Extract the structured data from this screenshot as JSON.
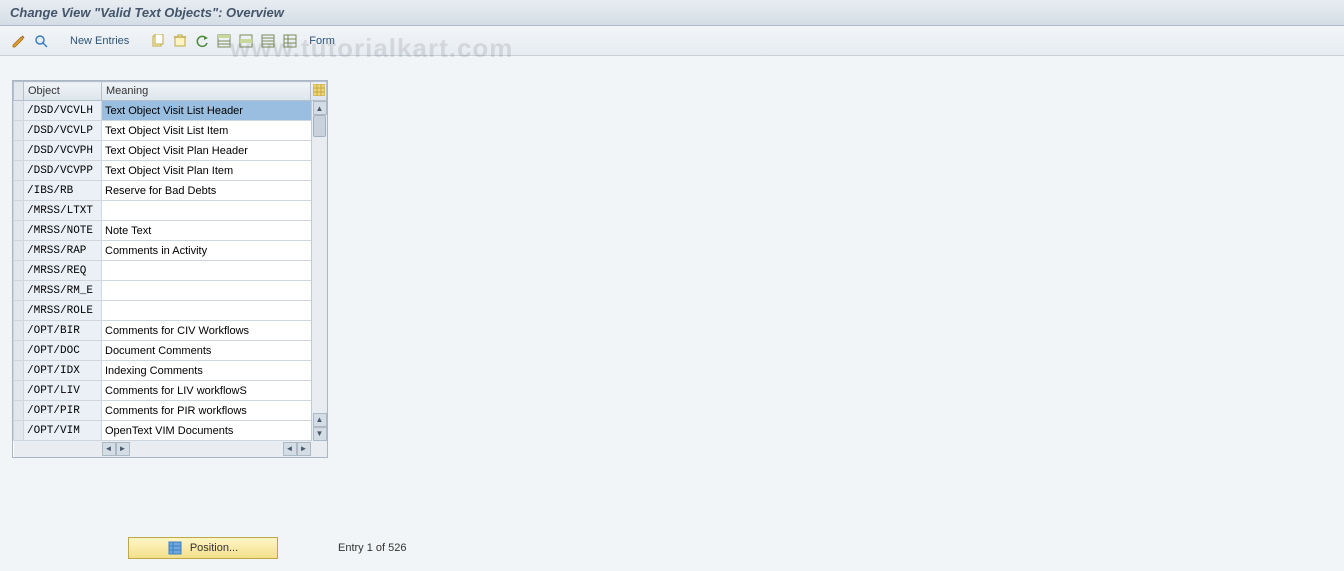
{
  "title": "Change View \"Valid Text Objects\": Overview",
  "toolbar": {
    "new_entries": "New Entries",
    "form": "Form"
  },
  "watermark": "www.tutorialkart.com",
  "table": {
    "col_object": "Object",
    "col_meaning": "Meaning",
    "rows": [
      {
        "object": "/DSD/VCVLH",
        "meaning": "Text Object Visit List Header",
        "selected": true
      },
      {
        "object": "/DSD/VCVLP",
        "meaning": "Text Object Visit List Item"
      },
      {
        "object": "/DSD/VCVPH",
        "meaning": "Text Object Visit Plan Header"
      },
      {
        "object": "/DSD/VCVPP",
        "meaning": "Text Object Visit Plan Item"
      },
      {
        "object": "/IBS/RB",
        "meaning": "Reserve for Bad Debts"
      },
      {
        "object": "/MRSS/LTXT",
        "meaning": ""
      },
      {
        "object": "/MRSS/NOTE",
        "meaning": "Note Text"
      },
      {
        "object": "/MRSS/RAP",
        "meaning": "Comments in Activity"
      },
      {
        "object": "/MRSS/REQ",
        "meaning": ""
      },
      {
        "object": "/MRSS/RM_E",
        "meaning": ""
      },
      {
        "object": "/MRSS/ROLE",
        "meaning": ""
      },
      {
        "object": "/OPT/BIR",
        "meaning": "Comments for CIV Workflows"
      },
      {
        "object": "/OPT/DOC",
        "meaning": "Document Comments"
      },
      {
        "object": "/OPT/IDX",
        "meaning": "Indexing Comments"
      },
      {
        "object": "/OPT/LIV",
        "meaning": "Comments for LIV workflowS"
      },
      {
        "object": "/OPT/PIR",
        "meaning": "Comments for PIR workflows"
      },
      {
        "object": "/OPT/VIM",
        "meaning": "OpenText VIM Documents"
      }
    ]
  },
  "footer": {
    "position_label": "Position...",
    "entry_status": "Entry 1 of 526"
  }
}
